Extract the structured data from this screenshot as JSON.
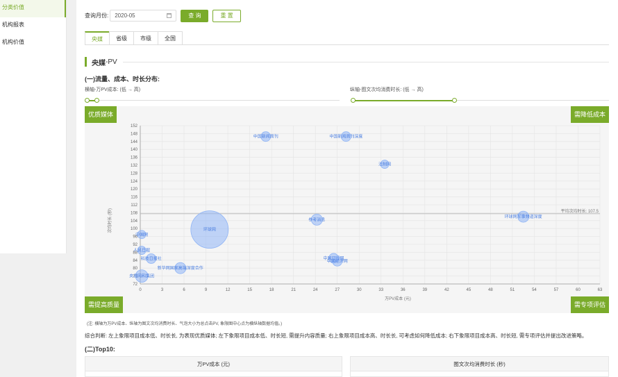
{
  "sidebar": {
    "items": [
      {
        "label": "分类价值",
        "active": true
      },
      {
        "label": "机构报表",
        "active": false
      },
      {
        "label": "机构价值",
        "active": false
      }
    ]
  },
  "query": {
    "label": "查询月份:",
    "month_value": "2020-05",
    "search_label": "查 询",
    "reset_label": "重 置"
  },
  "tabs": [
    {
      "label": "央媒",
      "active": true
    },
    {
      "label": "省级",
      "active": false
    },
    {
      "label": "市级",
      "active": false
    },
    {
      "label": "全国",
      "active": false
    }
  ],
  "section": {
    "title": "央媒",
    "suffix": "-PV"
  },
  "subsection_title": "(一)流量、成本、时长分布:",
  "axis_notes": {
    "x": "横轴-万PV成本: (低 → 高)",
    "y": "纵轴-图文次均消费时长: (低 → 高)"
  },
  "corners": {
    "top_left": "优质媒体",
    "top_right": "需降低成本",
    "bottom_left": "需提高质量",
    "bottom_right": "需专项评估"
  },
  "chart_data": {
    "type": "scatter",
    "xlabel": "万PV成本 (元)",
    "ylabel": "次均时长 (秒)",
    "xlim": [
      0,
      63
    ],
    "ylim": [
      72,
      152
    ],
    "xticks": [
      0,
      3,
      6,
      9,
      12,
      15,
      18,
      21,
      24,
      27,
      30,
      33,
      36,
      39,
      42,
      45,
      48,
      51,
      54,
      57,
      60,
      63
    ],
    "yticks": [
      72,
      76,
      80,
      84,
      88,
      92,
      96,
      100,
      104,
      108,
      112,
      116,
      120,
      124,
      128,
      132,
      136,
      140,
      144,
      148,
      152
    ],
    "avg_line": {
      "y": 107.5,
      "label": "平均次均时长: 107.5"
    },
    "bubble_color": "#8fb4f5",
    "points": [
      {
        "name": "中国新闻周刊",
        "x": 17.2,
        "y": 146.5,
        "size": 5
      },
      {
        "name": "中国新闻周刊深度",
        "x": 28.2,
        "y": 146.5,
        "size": 5
      },
      {
        "name": "法制网",
        "x": 33.5,
        "y": 132.5,
        "size": 4
      },
      {
        "name": "环球网",
        "x": 9.5,
        "y": 99.5,
        "size": 25
      },
      {
        "name": "参考消息",
        "x": 24.2,
        "y": 104.5,
        "size": 6
      },
      {
        "name": "环球网军事频道深度",
        "x": 52.5,
        "y": 106,
        "size": 6
      },
      {
        "name": "中国网",
        "x": 0.2,
        "y": 97,
        "size": 4
      },
      {
        "name": "人民日报",
        "x": 0.2,
        "y": 89,
        "size": 4
      },
      {
        "name": "科技日报社",
        "x": 1.5,
        "y": 84.8,
        "size": 5
      },
      {
        "name": "中国日报网",
        "x": 26.5,
        "y": 85,
        "size": 5
      },
      {
        "name": "中国经济网",
        "x": 27.0,
        "y": 83.5,
        "size": 5
      },
      {
        "name": "新华网国家高端深度合作",
        "x": 5.5,
        "y": 80,
        "size": 6
      },
      {
        "name": "央视网和集团",
        "x": 0.2,
        "y": 76,
        "size": 7
      }
    ]
  },
  "chart_note": "(注: 横轴为万PV成本、纵轴为图文次均消费时长、气泡大小为总点击PV, 象限图中心点为横纵轴数据均值。)",
  "judgement": "综合判断: 左上象限项目成本低、时长长, 为表现优质媒体; 左下象限项目成本低、时长短, 需提升内容质量; 右上象限项目成本高、时长长, 可考虑如何降低成本; 右下象限项目成本高、时长短, 需专项评估并提出改进策略。",
  "top10": {
    "title": "(二)Top10:",
    "col_left": "万PV成本 (元)",
    "col_right": "图文次均消费时长 (秒)"
  }
}
